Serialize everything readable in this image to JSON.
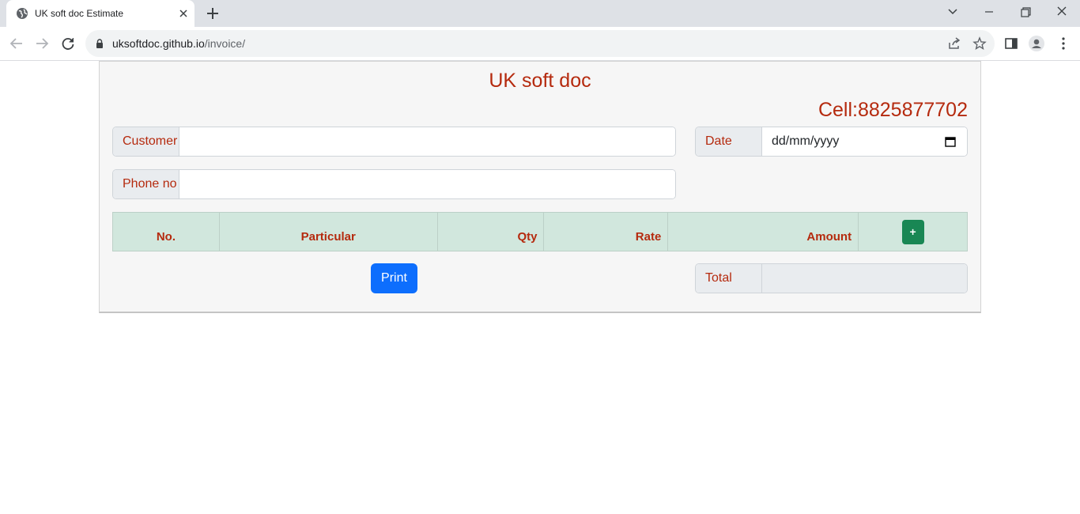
{
  "browser": {
    "tab_title": "UK soft doc Estimate",
    "url_host": "uksoftdoc.github.io",
    "url_path": "/invoice/"
  },
  "page": {
    "brand": "UK soft doc",
    "cell": "Cell:8825877702",
    "customer": {
      "label": "Customer",
      "value": ""
    },
    "phone": {
      "label": "Phone no",
      "value": ""
    },
    "date": {
      "label": "Date",
      "placeholder": "dd/mm/yyyy"
    },
    "table": {
      "headers": [
        "No.",
        "Particular",
        "Qty",
        "Rate",
        "Amount"
      ],
      "add_label": "+"
    },
    "print_label": "Print",
    "total": {
      "label": "Total",
      "value": ""
    }
  },
  "colors": {
    "accent": "#b52a0e",
    "table_header": "#d1e7dd",
    "print_button": "#0d6efd",
    "add_button": "#198754"
  }
}
